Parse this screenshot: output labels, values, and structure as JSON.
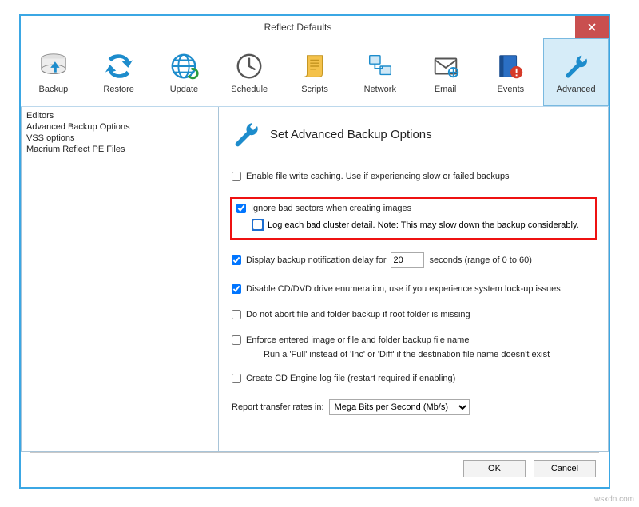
{
  "window": {
    "title": "Reflect Defaults"
  },
  "toolbar": {
    "items": [
      {
        "label": "Backup"
      },
      {
        "label": "Restore"
      },
      {
        "label": "Update"
      },
      {
        "label": "Schedule"
      },
      {
        "label": "Scripts"
      },
      {
        "label": "Network"
      },
      {
        "label": "Email"
      },
      {
        "label": "Events"
      },
      {
        "label": "Advanced"
      }
    ]
  },
  "sidebar": {
    "items": [
      "Editors",
      "Advanced Backup Options",
      "VSS options",
      "Macrium Reflect PE Files"
    ]
  },
  "panel": {
    "title": "Set Advanced Backup Options",
    "enable_file_write_caching": "Enable file write caching. Use if experiencing slow or failed backups",
    "ignore_bad_sectors": "Ignore bad sectors when creating images",
    "log_bad_cluster": "Log each bad cluster detail. Note: This may slow down the backup considerably.",
    "display_notification_pre": "Display backup notification delay for",
    "display_notification_value": "20",
    "display_notification_post": "seconds (range of 0 to 60)",
    "disable_cddvd": "Disable CD/DVD drive enumeration, use if you experience system lock-up issues",
    "do_not_abort": "Do not abort file and folder backup if root folder is missing",
    "enforce_name": "Enforce entered image or file and folder backup file name",
    "enforce_name_sub": "Run a 'Full' instead of 'Inc' or 'Diff' if the destination file name doesn't exist",
    "create_cd_log": "Create CD Engine log file (restart required if enabling)",
    "report_rates_label": "Report transfer rates in:",
    "report_rates_value": "Mega Bits per Second (Mb/s)"
  },
  "buttons": {
    "ok": "OK",
    "cancel": "Cancel"
  },
  "watermark": "wsxdn.com"
}
